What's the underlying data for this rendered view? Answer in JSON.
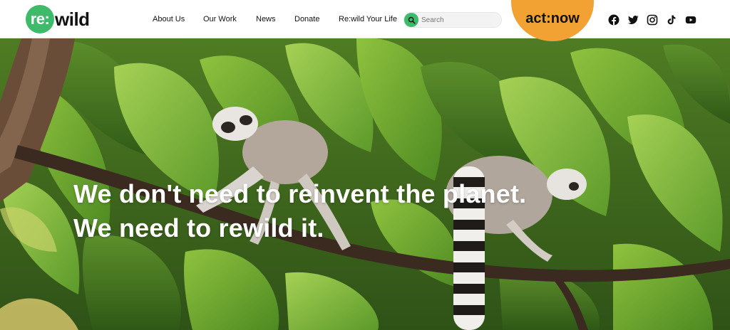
{
  "brand": {
    "logo_mark": "re:",
    "logo_word": "wild",
    "green": "#3dbb6a",
    "orange": "#f2a133"
  },
  "nav": {
    "items": [
      {
        "label": "About Us"
      },
      {
        "label": "Our Work"
      },
      {
        "label": "News"
      },
      {
        "label": "Donate"
      },
      {
        "label": "Re:wild Your Life"
      }
    ]
  },
  "search": {
    "placeholder": "Search",
    "icon": "search-icon"
  },
  "cta": {
    "label": "act:now"
  },
  "social": [
    {
      "name": "facebook-icon"
    },
    {
      "name": "twitter-icon"
    },
    {
      "name": "instagram-icon"
    },
    {
      "name": "tiktok-icon"
    },
    {
      "name": "youtube-icon"
    }
  ],
  "hero": {
    "headline_line1": "We don't need to reinvent the planet.",
    "headline_line2": "We need to rewild it."
  }
}
